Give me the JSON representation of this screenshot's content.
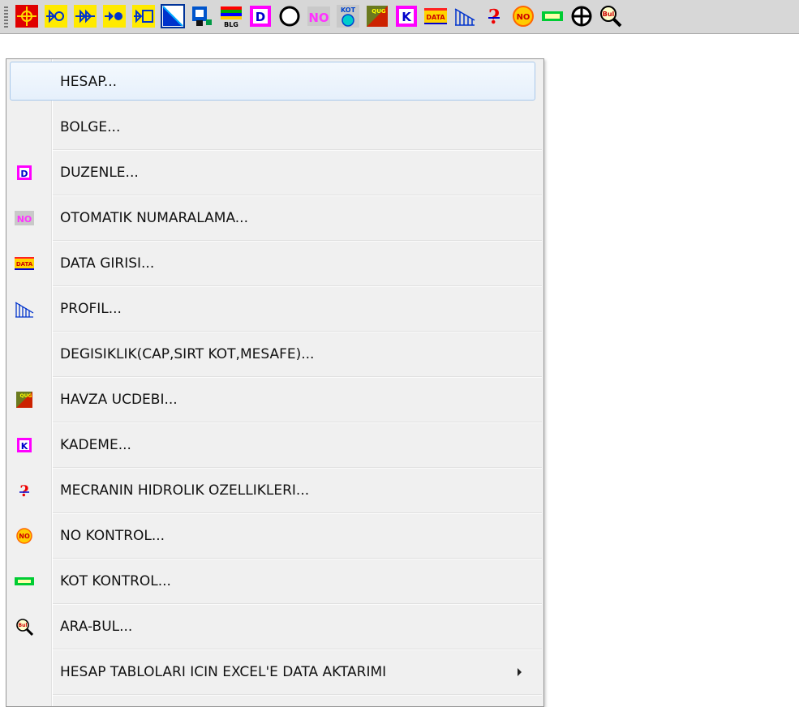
{
  "toolbar": {
    "buttons": [
      {
        "name": "target-icon"
      },
      {
        "name": "valve-open-icon"
      },
      {
        "name": "valve-double-arrow-icon"
      },
      {
        "name": "valve-filled-icon"
      },
      {
        "name": "valve-box-icon"
      },
      {
        "name": "diagonal-section-icon"
      },
      {
        "name": "device-icon"
      },
      {
        "name": "blg-icon",
        "text": "BLG"
      },
      {
        "name": "edit-d-icon",
        "text": "D"
      },
      {
        "name": "circle-icon"
      },
      {
        "name": "auto-number-icon",
        "text": "NO"
      },
      {
        "name": "kot-icon",
        "text": "KOT"
      },
      {
        "name": "basin-icon",
        "text": "QUG"
      },
      {
        "name": "kademe-k-icon",
        "text": "K"
      },
      {
        "name": "data-entry-icon",
        "text": "DATA"
      },
      {
        "name": "profile-icon"
      },
      {
        "name": "question-icon",
        "text": "?"
      },
      {
        "name": "no-control-icon",
        "text": "NO"
      },
      {
        "name": "kot-control-icon"
      },
      {
        "name": "crosshair-icon"
      },
      {
        "name": "search-bul-icon",
        "text": "Bul"
      }
    ]
  },
  "menu": {
    "items": [
      {
        "label": "HESAP...",
        "icon": "none",
        "highlighted": true
      },
      {
        "label": "BOLGE...",
        "icon": "none"
      },
      {
        "label": "DUZENLE...",
        "icon": "edit-d-icon"
      },
      {
        "label": "OTOMATIK NUMARALAMA...",
        "icon": "auto-number-icon"
      },
      {
        "label": "DATA GIRISI...",
        "icon": "data-entry-icon"
      },
      {
        "label": "PROFIL...",
        "icon": "profile-icon"
      },
      {
        "label": "DEGISIKLIK(CAP,SIRT KOT,MESAFE)...",
        "icon": "none"
      },
      {
        "label": "HAVZA UCDEBI...",
        "icon": "basin-icon"
      },
      {
        "label": "KADEME...",
        "icon": "kademe-k-icon"
      },
      {
        "label": "MECRANIN HIDROLIK OZELLIKLERI...",
        "icon": "question-icon"
      },
      {
        "label": "NO KONTROL...",
        "icon": "no-control-icon"
      },
      {
        "label": "KOT KONTROL...",
        "icon": "kot-control-icon"
      },
      {
        "label": "ARA-BUL...",
        "icon": "search-bul-icon"
      },
      {
        "label": "HESAP TABLOLARI ICIN EXCEL'E DATA AKTARIMI",
        "icon": "none",
        "submenu": true
      }
    ]
  },
  "colors": {
    "menu_bg": "#f0f0f0",
    "highlight_border": "#a9c8ea",
    "toolbar_bg": "#d7d7d7"
  }
}
